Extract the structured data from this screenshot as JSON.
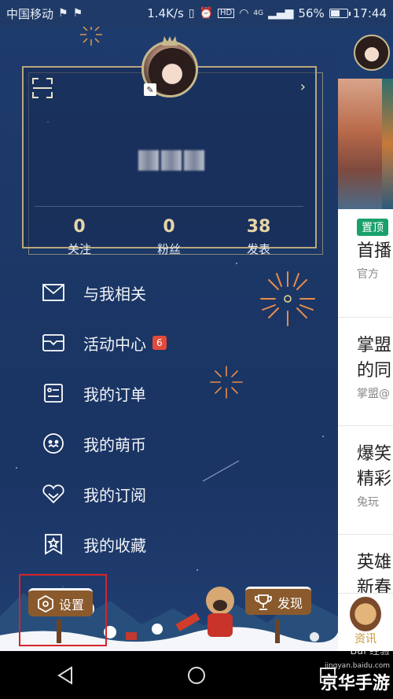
{
  "status_bar": {
    "carrier": "中国移动",
    "speed": "1.4K/s",
    "network": "4G",
    "battery_text": "56%",
    "battery_level": 0.56,
    "time": "17:44"
  },
  "profile": {
    "stats": [
      {
        "value": "0",
        "label": "关注"
      },
      {
        "value": "0",
        "label": "粉丝"
      },
      {
        "value": "38",
        "label": "发表"
      }
    ]
  },
  "menu": {
    "items": [
      {
        "label": "与我相关",
        "icon": "mail-icon"
      },
      {
        "label": "活动中心",
        "icon": "ticket-icon",
        "badge": "6"
      },
      {
        "label": "我的订单",
        "icon": "order-icon"
      },
      {
        "label": "我的萌币",
        "icon": "coin-icon"
      },
      {
        "label": "我的订阅",
        "icon": "heart-icon"
      },
      {
        "label": "我的收藏",
        "icon": "bookmark-star-icon"
      }
    ]
  },
  "bottom": {
    "settings_label": "设置",
    "discover_label": "发现"
  },
  "content_panel": {
    "feed": [
      {
        "tag": "置顶",
        "title": "首播",
        "meta": "官方"
      },
      {
        "tag": "",
        "title": "掌盟",
        "title2": "的同",
        "meta": "掌盟@"
      },
      {
        "tag": "",
        "title": "爆笑",
        "title2": "精彩",
        "meta": "兔玩"
      },
      {
        "tag": "",
        "title": "英雄",
        "title2": "新春",
        "meta": ""
      }
    ],
    "tab_label": "资讯"
  },
  "watermark": {
    "brand": "Bai 经验",
    "site": "jingyan.baidu.com",
    "overlay": "京华手游"
  },
  "colors": {
    "drawer_bg": "#1e3b6e",
    "gold": "#b8a77a",
    "badge_red": "#e24a3b",
    "highlight_red": "#d8232a",
    "tag_green": "#1aa06a"
  }
}
